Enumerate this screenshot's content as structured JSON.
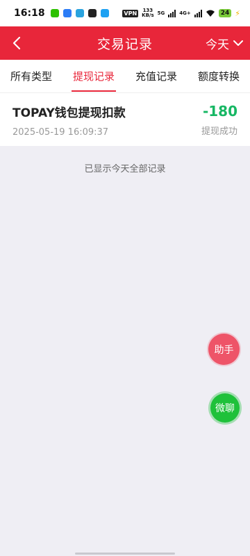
{
  "status_bar": {
    "time": "16:18",
    "vpn": "VPN",
    "speed_value": "133",
    "speed_unit": "KB/s",
    "signal_1": "5G",
    "signal_2": "4G+",
    "battery": "24",
    "app_icons": [
      "wechat-icon",
      "app-icon",
      "telegram-icon",
      "app-icon",
      "app-icon"
    ]
  },
  "header": {
    "title": "交易记录",
    "date_filter": "今天",
    "accent_color": "#e8263a"
  },
  "tabs": [
    {
      "label": "所有类型",
      "active": false
    },
    {
      "label": "提现记录",
      "active": true
    },
    {
      "label": "充值记录",
      "active": false
    },
    {
      "label": "额度转换",
      "active": false
    }
  ],
  "records": [
    {
      "title": "TOPAY钱包提现扣款",
      "time": "2025-05-19 16:09:37",
      "amount": "-180",
      "status": "提现成功",
      "amount_color": "#17b764"
    }
  ],
  "end_note": "已显示今天全部记录",
  "floating": {
    "assistant_label": "助手",
    "wechat_label": "微聊"
  }
}
